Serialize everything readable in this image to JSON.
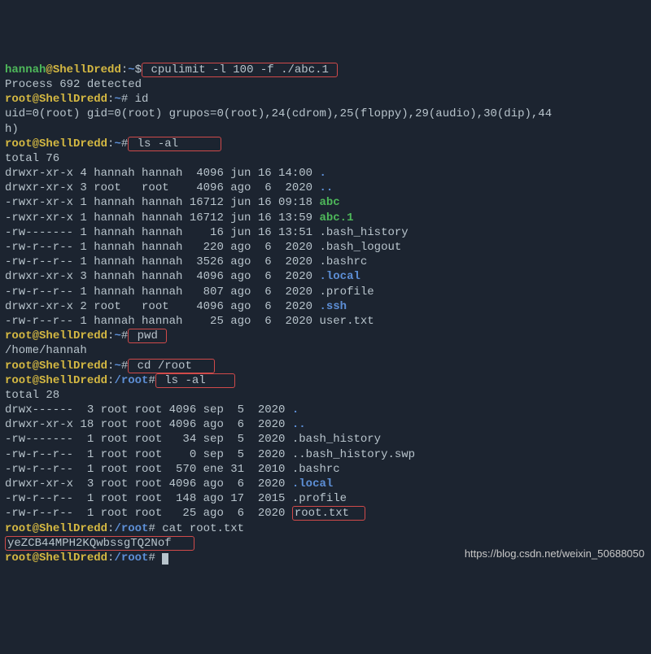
{
  "line0": {
    "user": "hannah",
    "host": "ShellDredd",
    "path": "~",
    "sym": "$",
    "cmd": " cpulimit -l 100 -f ./abc.1 "
  },
  "line1": "Process 692 detected",
  "line2": {
    "user": "root",
    "host": "ShellDredd",
    "path": "~",
    "sym": "#",
    "cmd": " id"
  },
  "line3": "uid=0(root) gid=0(root) grupos=0(root),24(cdrom),25(floppy),29(audio),30(dip),44",
  "line3b": "h)",
  "line4": {
    "user": "root",
    "host": "ShellDredd",
    "path": "~",
    "sym": "#",
    "cmd": " ls -al      "
  },
  "line5": "total 76",
  "ls1": [
    {
      "perm": "drwxr-xr-x",
      "ln": "4",
      "own": "hannah",
      "grp": "hannah",
      "size": " 4096",
      "mo": "jun",
      "dd": "16",
      "tm": "14:00",
      "name": ".",
      "cls": "dir-blue"
    },
    {
      "perm": "drwxr-xr-x",
      "ln": "3",
      "own": "root  ",
      "grp": "root  ",
      "size": " 4096",
      "mo": "ago",
      "dd": " 6",
      "tm": " 2020",
      "name": "..",
      "cls": "dir-blue"
    },
    {
      "perm": "-rwxr-xr-x",
      "ln": "1",
      "own": "hannah",
      "grp": "hannah",
      "size": "16712",
      "mo": "jun",
      "dd": "16",
      "tm": "09:18",
      "name": "abc",
      "cls": "exec-green"
    },
    {
      "perm": "-rwxr-xr-x",
      "ln": "1",
      "own": "hannah",
      "grp": "hannah",
      "size": "16712",
      "mo": "jun",
      "dd": "16",
      "tm": "13:59",
      "name": "abc.1",
      "cls": "exec-green"
    },
    {
      "perm": "-rw-------",
      "ln": "1",
      "own": "hannah",
      "grp": "hannah",
      "size": "   16",
      "mo": "jun",
      "dd": "16",
      "tm": "13:51",
      "name": ".bash_history",
      "cls": ""
    },
    {
      "perm": "-rw-r--r--",
      "ln": "1",
      "own": "hannah",
      "grp": "hannah",
      "size": "  220",
      "mo": "ago",
      "dd": " 6",
      "tm": " 2020",
      "name": ".bash_logout",
      "cls": ""
    },
    {
      "perm": "-rw-r--r--",
      "ln": "1",
      "own": "hannah",
      "grp": "hannah",
      "size": " 3526",
      "mo": "ago",
      "dd": " 6",
      "tm": " 2020",
      "name": ".bashrc",
      "cls": ""
    },
    {
      "perm": "drwxr-xr-x",
      "ln": "3",
      "own": "hannah",
      "grp": "hannah",
      "size": " 4096",
      "mo": "ago",
      "dd": " 6",
      "tm": " 2020",
      "name": ".local",
      "cls": "dir-blue"
    },
    {
      "perm": "-rw-r--r--",
      "ln": "1",
      "own": "hannah",
      "grp": "hannah",
      "size": "  807",
      "mo": "ago",
      "dd": " 6",
      "tm": " 2020",
      "name": ".profile",
      "cls": ""
    },
    {
      "perm": "drwxr-xr-x",
      "ln": "2",
      "own": "root  ",
      "grp": "root  ",
      "size": " 4096",
      "mo": "ago",
      "dd": " 6",
      "tm": " 2020",
      "name": ".ssh",
      "cls": "dir-blue"
    },
    {
      "perm": "-rw-r--r--",
      "ln": "1",
      "own": "hannah",
      "grp": "hannah",
      "size": "   25",
      "mo": "ago",
      "dd": " 6",
      "tm": " 2020",
      "name": "user.txt",
      "cls": ""
    }
  ],
  "line17": {
    "user": "root",
    "host": "ShellDredd",
    "path": "~",
    "sym": "#",
    "cmd": " pwd "
  },
  "line18": "/home/hannah",
  "line19": {
    "user": "root",
    "host": "ShellDredd",
    "path": "~",
    "sym": "#",
    "cmd": " cd /root   "
  },
  "line20": {
    "user": "root",
    "host": "ShellDredd",
    "path": "/root",
    "sym": "#",
    "cmd": " ls -al    "
  },
  "line21": "total 28",
  "ls2": [
    {
      "perm": "drwx------",
      "ln": " 3",
      "own": "root",
      "grp": "root",
      "size": "4096",
      "mo": "sep",
      "dd": " 5",
      "tm": " 2020",
      "name": ".",
      "cls": "dir-blue"
    },
    {
      "perm": "drwxr-xr-x",
      "ln": "18",
      "own": "root",
      "grp": "root",
      "size": "4096",
      "mo": "ago",
      "dd": " 6",
      "tm": " 2020",
      "name": "..",
      "cls": "dir-blue"
    },
    {
      "perm": "-rw-------",
      "ln": " 1",
      "own": "root",
      "grp": "root",
      "size": "  34",
      "mo": "sep",
      "dd": " 5",
      "tm": " 2020",
      "name": ".bash_history",
      "cls": ""
    },
    {
      "perm": "-rw-r--r--",
      "ln": " 1",
      "own": "root",
      "grp": "root",
      "size": "   0",
      "mo": "sep",
      "dd": " 5",
      "tm": " 2020",
      "name": "..bash_history.swp",
      "cls": ""
    },
    {
      "perm": "-rw-r--r--",
      "ln": " 1",
      "own": "root",
      "grp": "root",
      "size": " 570",
      "mo": "ene",
      "dd": "31",
      "tm": " 2010",
      "name": ".bashrc",
      "cls": ""
    },
    {
      "perm": "drwxr-xr-x",
      "ln": " 3",
      "own": "root",
      "grp": "root",
      "size": "4096",
      "mo": "ago",
      "dd": " 6",
      "tm": " 2020",
      "name": ".local",
      "cls": "dir-blue"
    },
    {
      "perm": "-rw-r--r--",
      "ln": " 1",
      "own": "root",
      "grp": "root",
      "size": " 148",
      "mo": "ago",
      "dd": "17",
      "tm": " 2015",
      "name": ".profile",
      "cls": ""
    },
    {
      "perm": "-rw-r--r--",
      "ln": " 1",
      "own": "root",
      "grp": "root",
      "size": "  25",
      "mo": "ago",
      "dd": " 6",
      "tm": " 2020",
      "name": "root.txt",
      "cls": "",
      "boxed": true
    }
  ],
  "line30": {
    "user": "root",
    "host": "ShellDredd",
    "path": "/root",
    "sym": "#",
    "cmd": " cat root.txt"
  },
  "line31": "yeZCB44MPH2KQwbssgTQ2Nof   ",
  "line32": {
    "user": "root",
    "host": "ShellDredd",
    "path": "/root",
    "sym": "#",
    "cmd": " "
  },
  "watermark": "https://blog.csdn.net/weixin_50688050"
}
